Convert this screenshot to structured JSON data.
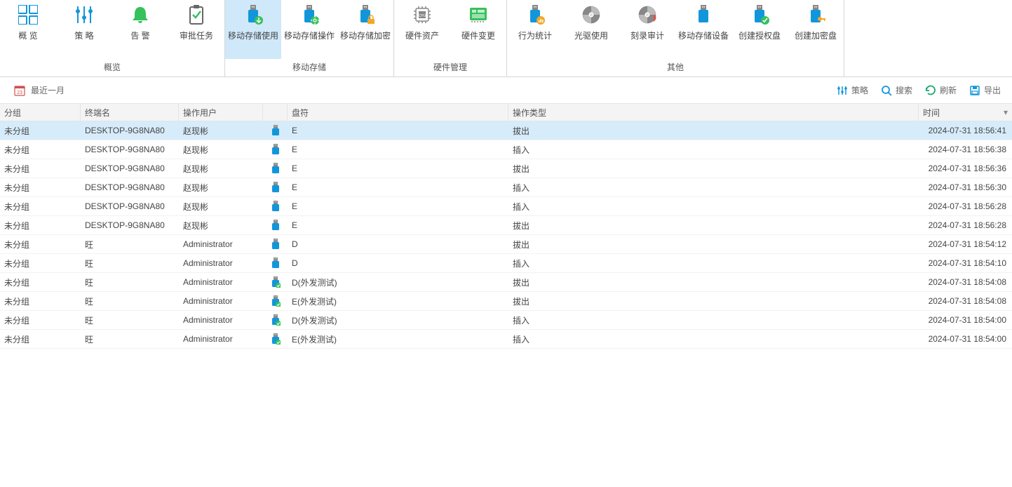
{
  "ribbon": {
    "groups": [
      {
        "label": "概览",
        "items": [
          {
            "id": "overview-icon",
            "label": "概 览",
            "icon": "grid",
            "active": false
          },
          {
            "id": "policy-icon",
            "label": "策 略",
            "icon": "sliders",
            "active": false
          },
          {
            "id": "alert-icon",
            "label": "告 警",
            "icon": "bell",
            "active": false
          },
          {
            "id": "approval-icon",
            "label": "审批任务",
            "icon": "clipboard",
            "active": false
          }
        ]
      },
      {
        "label": "移动存储",
        "items": [
          {
            "id": "storage-use-icon",
            "label": "移动存储使用",
            "icon": "usb-down",
            "active": true
          },
          {
            "id": "storage-op-icon",
            "label": "移动存储操作",
            "icon": "usb-gear",
            "active": false
          },
          {
            "id": "storage-enc-icon",
            "label": "移动存储加密",
            "icon": "usb-lock",
            "active": false
          }
        ]
      },
      {
        "label": "硬件管理",
        "items": [
          {
            "id": "hw-asset-icon",
            "label": "硬件资产",
            "icon": "cpu",
            "active": false
          },
          {
            "id": "hw-change-icon",
            "label": "硬件变更",
            "icon": "board",
            "active": false
          }
        ]
      },
      {
        "label": "其他",
        "items": [
          {
            "id": "behavior-icon",
            "label": "行为统计",
            "icon": "usb-chart",
            "active": false
          },
          {
            "id": "cd-use-icon",
            "label": "光驱使用",
            "icon": "disc",
            "active": false
          },
          {
            "id": "burn-audit-icon",
            "label": "刻录审计",
            "icon": "disc-fire",
            "active": false
          },
          {
            "id": "mobile-dev-icon",
            "label": "移动存储设备",
            "icon": "usb",
            "active": false
          },
          {
            "id": "auth-disk-icon",
            "label": "创建授权盘",
            "icon": "usb-check",
            "active": false
          },
          {
            "id": "enc-disk-icon",
            "label": "创建加密盘",
            "icon": "usb-key",
            "active": false
          }
        ]
      }
    ]
  },
  "toolbar": {
    "date_range": "最近一月",
    "right": [
      {
        "id": "policy",
        "label": "策略",
        "icon": "sliders-sm",
        "color": "#1296db"
      },
      {
        "id": "search",
        "label": "搜索",
        "icon": "search",
        "color": "#1296db"
      },
      {
        "id": "refresh",
        "label": "刷新",
        "icon": "refresh",
        "color": "#17a86b"
      },
      {
        "id": "export",
        "label": "导出",
        "icon": "save",
        "color": "#1296db"
      }
    ]
  },
  "table": {
    "columns": [
      "分组",
      "终端名",
      "操作用户",
      "",
      "盘符",
      "操作类型",
      "时间"
    ],
    "rows": [
      {
        "group": "未分组",
        "terminal": "DESKTOP-9G8NA80",
        "user": "赵现彬",
        "usb": "usb",
        "drive": "E",
        "op": "拔出",
        "time": "2024-07-31 18:56:41",
        "selected": true
      },
      {
        "group": "未分组",
        "terminal": "DESKTOP-9G8NA80",
        "user": "赵现彬",
        "usb": "usb",
        "drive": "E",
        "op": "插入",
        "time": "2024-07-31 18:56:38",
        "selected": false
      },
      {
        "group": "未分组",
        "terminal": "DESKTOP-9G8NA80",
        "user": "赵现彬",
        "usb": "usb",
        "drive": "E",
        "op": "拔出",
        "time": "2024-07-31 18:56:36",
        "selected": false
      },
      {
        "group": "未分组",
        "terminal": "DESKTOP-9G8NA80",
        "user": "赵现彬",
        "usb": "usb",
        "drive": "E",
        "op": "插入",
        "time": "2024-07-31 18:56:30",
        "selected": false
      },
      {
        "group": "未分组",
        "terminal": "DESKTOP-9G8NA80",
        "user": "赵现彬",
        "usb": "usb",
        "drive": "E",
        "op": "插入",
        "time": "2024-07-31 18:56:28",
        "selected": false
      },
      {
        "group": "未分组",
        "terminal": "DESKTOP-9G8NA80",
        "user": "赵现彬",
        "usb": "usb",
        "drive": "E",
        "op": "拔出",
        "time": "2024-07-31 18:56:28",
        "selected": false
      },
      {
        "group": "未分组",
        "terminal": "旺",
        "user": "Administrator",
        "usb": "usb",
        "drive": "D",
        "op": "拔出",
        "time": "2024-07-31 18:54:12",
        "selected": false
      },
      {
        "group": "未分组",
        "terminal": "旺",
        "user": "Administrator",
        "usb": "usb",
        "drive": "D",
        "op": "插入",
        "time": "2024-07-31 18:54:10",
        "selected": false
      },
      {
        "group": "未分组",
        "terminal": "旺",
        "user": "Administrator",
        "usb": "usb-ext",
        "drive": "D(外发测试)",
        "op": "拔出",
        "time": "2024-07-31 18:54:08",
        "selected": false
      },
      {
        "group": "未分组",
        "terminal": "旺",
        "user": "Administrator",
        "usb": "usb-ext",
        "drive": "E(外发测试)",
        "op": "拔出",
        "time": "2024-07-31 18:54:08",
        "selected": false
      },
      {
        "group": "未分组",
        "terminal": "旺",
        "user": "Administrator",
        "usb": "usb-ext",
        "drive": "D(外发测试)",
        "op": "插入",
        "time": "2024-07-31 18:54:00",
        "selected": false
      },
      {
        "group": "未分组",
        "terminal": "旺",
        "user": "Administrator",
        "usb": "usb-ext",
        "drive": "E(外发测试)",
        "op": "插入",
        "time": "2024-07-31 18:54:00",
        "selected": false
      }
    ]
  }
}
